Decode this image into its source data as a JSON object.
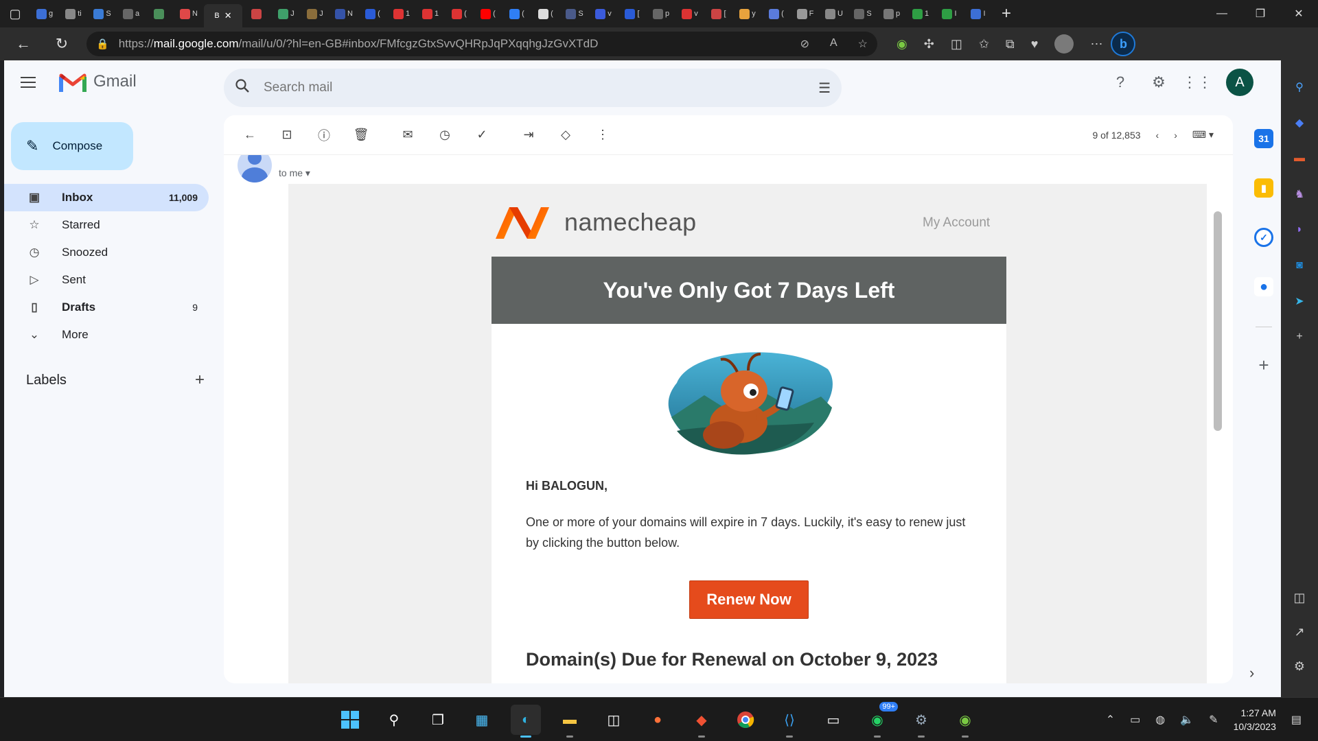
{
  "browser": {
    "active_tab_title": "B",
    "tab_letters": [
      "g",
      "ti",
      "S",
      "a",
      "",
      "N",
      "",
      "J",
      "J",
      "N",
      "(",
      "1",
      "1",
      "(",
      "(",
      "(",
      "(",
      "S",
      "v",
      "[",
      "p",
      "v",
      "[",
      "y",
      "(",
      "F",
      "U",
      "S",
      "p",
      "1",
      "I",
      "I"
    ],
    "url_prefix": "https://",
    "url_host": "mail.google.com",
    "url_path": "/mail/u/0/?hl=en-GB#inbox/FMfcgzGtxSvvQHRpJqPXqqhgJzGvXTdD"
  },
  "gmail": {
    "app_name": "Gmail",
    "search_placeholder": "Search mail",
    "avatar_letter": "A",
    "compose_label": "Compose",
    "nav": [
      {
        "label": "Inbox",
        "count": "11,009"
      },
      {
        "label": "Starred",
        "count": ""
      },
      {
        "label": "Snoozed",
        "count": ""
      },
      {
        "label": "Sent",
        "count": ""
      },
      {
        "label": "Drafts",
        "count": "9"
      },
      {
        "label": "More",
        "count": ""
      }
    ],
    "labels_heading": "Labels",
    "pagination": "9 of 12,853",
    "to_me": "to me"
  },
  "email": {
    "brand": "namecheap",
    "my_account": "My Account",
    "banner": "You've Only Got 7 Days Left",
    "greeting": "Hi BALOGUN,",
    "body": "One or more of your domains will expire in 7 days. Luckily, it's easy to renew just by clicking the button below.",
    "button": "Renew Now",
    "due_heading": "Domain(s) Due for Renewal on October 9, 2023"
  },
  "taskbar": {
    "whatsapp_badge": "99+",
    "time": "1:27 AM",
    "date": "10/3/2023"
  },
  "colors": {
    "accent_orange": "#e54b1c",
    "banner_gray": "#5f6362",
    "compose_blue": "#c2e7ff",
    "inbox_active": "#d3e3fd"
  }
}
